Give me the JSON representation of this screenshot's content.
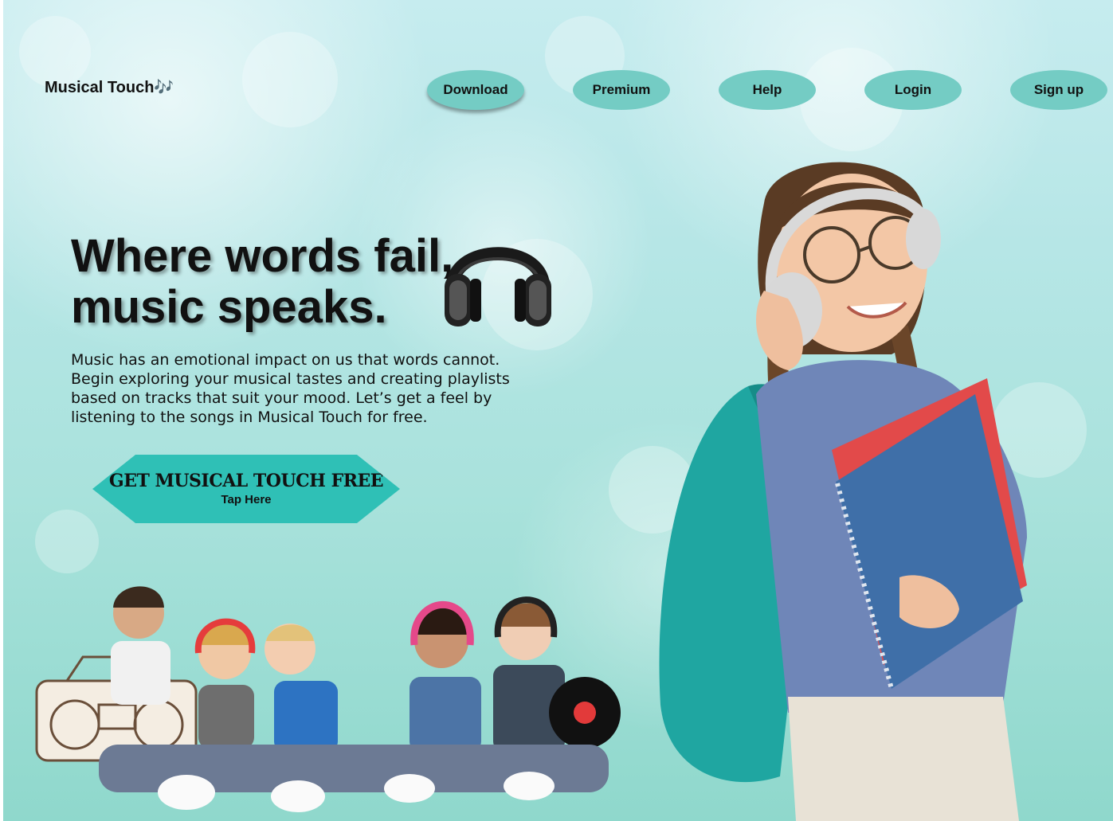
{
  "header": {
    "brand": "Musical Touch🎶",
    "nav": [
      {
        "label": "Download"
      },
      {
        "label": "Premium"
      },
      {
        "label": "Help"
      },
      {
        "label": "Login"
      },
      {
        "label": "Sign up"
      }
    ],
    "active_nav": "Download"
  },
  "hero": {
    "headline_line1": "Where words fail,",
    "headline_line2": "music speaks.",
    "description": "Music has an emotional impact on us that words cannot. Begin exploring your musical tastes and creating playlists based on tracks that suit your mood. Let’s get a feel by listening to the songs in Musical Touch for free.",
    "cta_title": "GET MUSICAL TOUCH FREE",
    "cta_subtitle": "Tap Here"
  },
  "images": {
    "headphones": "headphones-icon",
    "girl": "girl-with-headphones-photo",
    "kids": "kids-group-photo"
  },
  "colors": {
    "nav_button": "#74ccc4",
    "cta_button": "#2fc0b6",
    "background_top": "#c6ecef",
    "background_bottom": "#8fd8cc",
    "text": "#111111"
  }
}
